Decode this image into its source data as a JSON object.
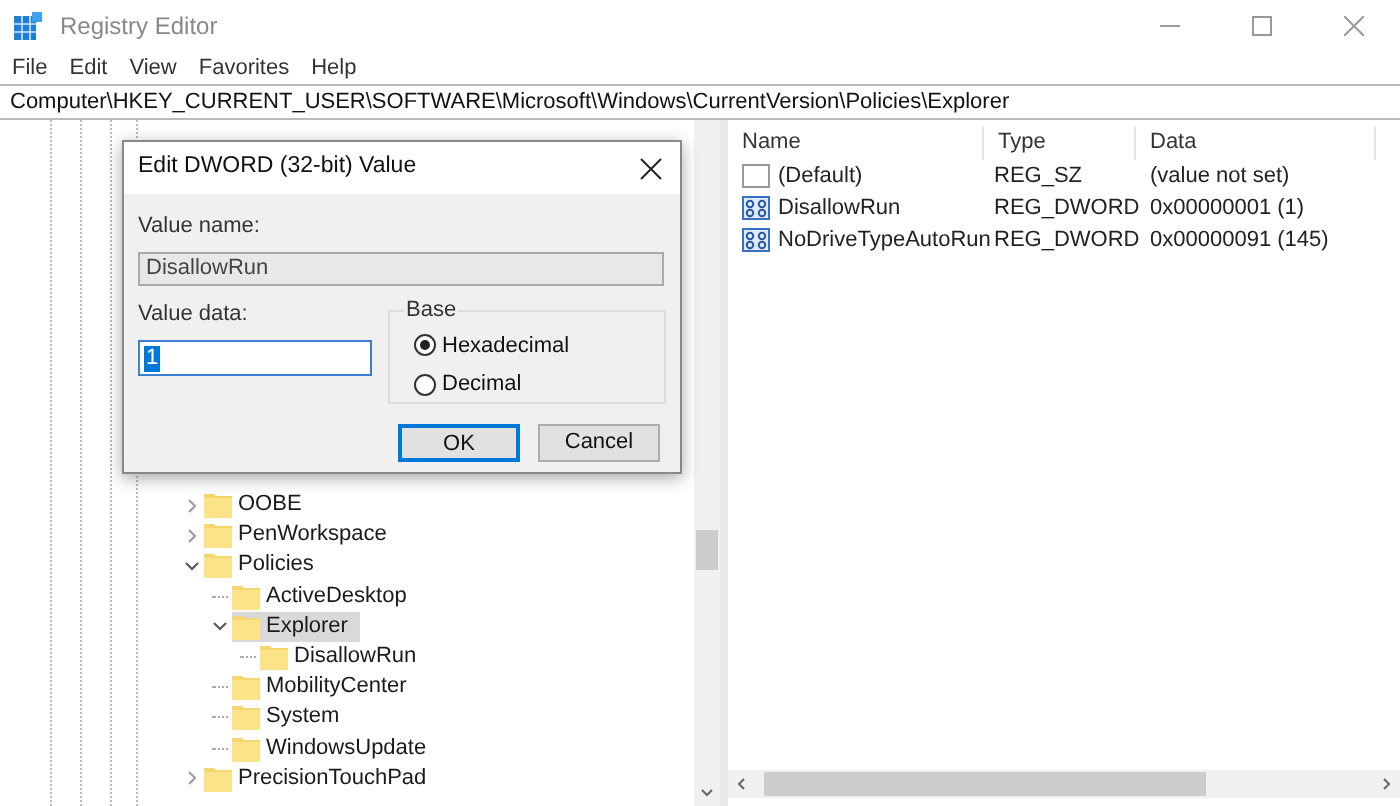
{
  "window": {
    "title": "Registry Editor"
  },
  "menu": [
    "File",
    "Edit",
    "View",
    "Favorites",
    "Help"
  ],
  "address": "Computer\\HKEY_CURRENT_USER\\SOFTWARE\\Microsoft\\Windows\\CurrentVersion\\Policies\\Explorer",
  "tree": [
    {
      "label": "OOBE",
      "expanded": false,
      "selected": false
    },
    {
      "label": "PenWorkspace",
      "expanded": false,
      "selected": false
    },
    {
      "label": "Policies",
      "expanded": true,
      "selected": false,
      "children": [
        {
          "label": "ActiveDesktop",
          "selected": false
        },
        {
          "label": "Explorer",
          "expanded": true,
          "selected": true,
          "children": [
            {
              "label": "DisallowRun",
              "selected": false
            }
          ]
        },
        {
          "label": "MobilityCenter",
          "selected": false
        },
        {
          "label": "System",
          "selected": false
        },
        {
          "label": "WindowsUpdate",
          "selected": false
        }
      ]
    },
    {
      "label": "PrecisionTouchPad",
      "expanded": false,
      "selected": false
    }
  ],
  "values": {
    "columns": [
      "Name",
      "Type",
      "Data"
    ],
    "rows": [
      {
        "kind": "string",
        "name": "(Default)",
        "type": "REG_SZ",
        "data": "(value not set)"
      },
      {
        "kind": "binary",
        "name": "DisallowRun",
        "type": "REG_DWORD",
        "data": "0x00000001 (1)"
      },
      {
        "kind": "binary",
        "name": "NoDriveTypeAutoRun",
        "type": "REG_DWORD",
        "data": "0x00000091 (145)"
      }
    ]
  },
  "dialog": {
    "title": "Edit DWORD (32-bit) Value",
    "name_label": "Value name:",
    "name_value": "DisallowRun",
    "data_label": "Value data:",
    "data_value": "1",
    "base_label": "Base",
    "base_options": [
      {
        "label": "Hexadecimal",
        "selected": true
      },
      {
        "label": "Decimal",
        "selected": false
      }
    ],
    "buttons": [
      "OK",
      "Cancel"
    ]
  }
}
